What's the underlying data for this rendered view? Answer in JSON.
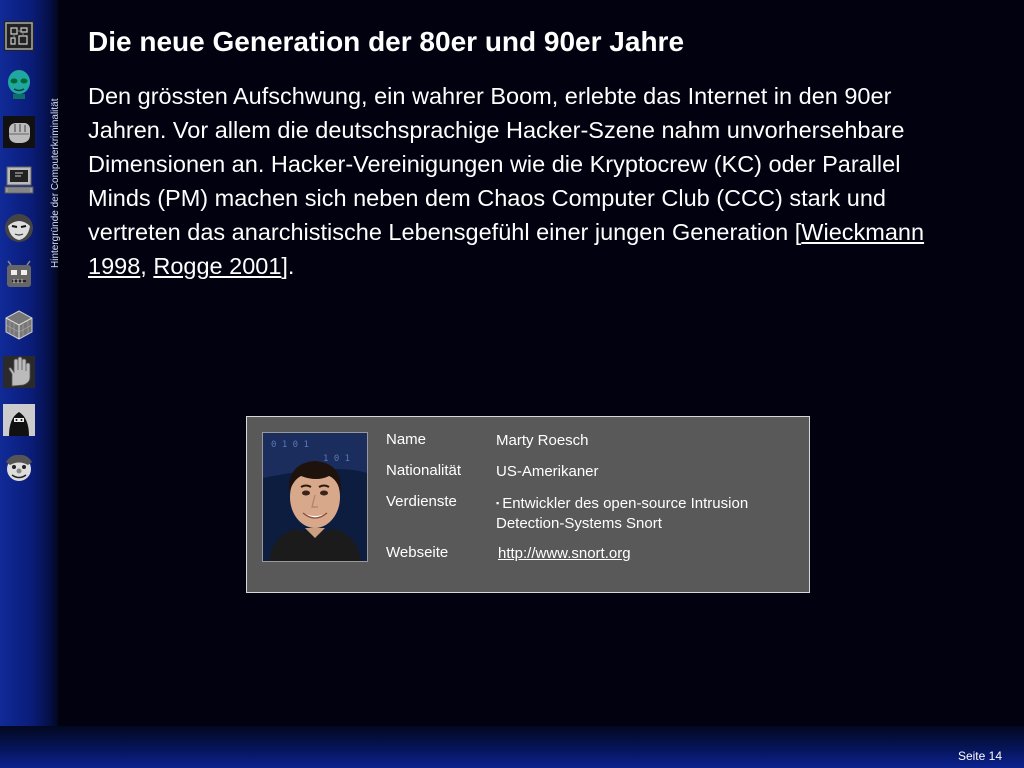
{
  "slide": {
    "title": "Die neue Generation der 80er und 90er Jahre",
    "side_label": "Hintergründe der Computerkriminalität",
    "body": {
      "text_main": "Den grössten Aufschwung, ein wahrer Boom, erlebte das Internet in den 90er Jahren. Vor allem die deutschsprachige Hacker-Szene nahm unvorhersehbare Dimensionen an. Hacker-Vereinigungen wie die Kryptocrew (KC) oder Parallel Minds (PM) machen sich neben dem Chaos Computer Club (CCC) stark und vertreten das anarchistische Lebensgefühl einer jungen Generation [",
      "ref1": "Wieckmann 1998",
      "sep": ", ",
      "ref2": "Rogge 2001",
      "end": "]."
    },
    "card": {
      "rows": [
        {
          "label": "Name",
          "value": "Marty Roesch"
        },
        {
          "label": "Nationalität",
          "value": "US-Amerikaner"
        },
        {
          "label": "Verdienste",
          "value": "Entwickler des open-source Intrusion Detection-Systems Snort",
          "bullet": "▪"
        },
        {
          "label": "Webseite",
          "value": "http://www.snort.org"
        }
      ]
    },
    "page_number": "Seite 14"
  },
  "icons": [
    "circuit-icon",
    "alien-face-icon",
    "fist-icon",
    "computer-icon",
    "mask-face-icon",
    "robot-face-icon",
    "grid-cube-icon",
    "hand-icon",
    "hooded-figure-icon",
    "clown-face-icon"
  ],
  "colors": {
    "background": "#01010f",
    "sidebar": "#0a1c78",
    "card": "#595959",
    "text": "#ffffff"
  }
}
